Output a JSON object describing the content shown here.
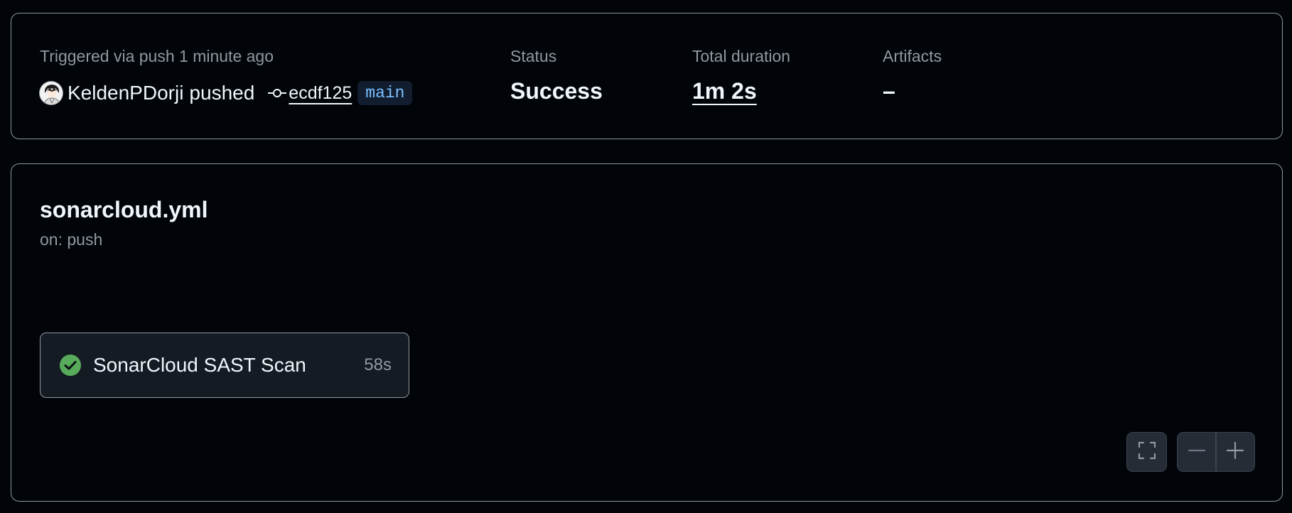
{
  "summary": {
    "trigger_label": "Triggered via push 1 minute ago",
    "actor": "KeldenPDorji",
    "action": "pushed",
    "commit_sha": "ecdf125",
    "branch": "main",
    "status_label": "Status",
    "status_value": "Success",
    "duration_label": "Total duration",
    "duration_value": "1m 2s",
    "artifacts_label": "Artifacts",
    "artifacts_value": "–"
  },
  "workflow": {
    "file": "sonarcloud.yml",
    "trigger": "on: push",
    "jobs": [
      {
        "name": "SonarCloud SAST Scan",
        "duration": "58s",
        "status": "success"
      }
    ]
  },
  "controls": {
    "fullscreen_icon": "fullscreen-icon",
    "zoom_out_icon": "minus-icon",
    "zoom_in_icon": "plus-icon"
  },
  "colors": {
    "background": "#010409",
    "border": "#9198a1",
    "success": "#57ab5a",
    "branch_text": "#79c0ff",
    "branch_bg": "#121d2f"
  }
}
